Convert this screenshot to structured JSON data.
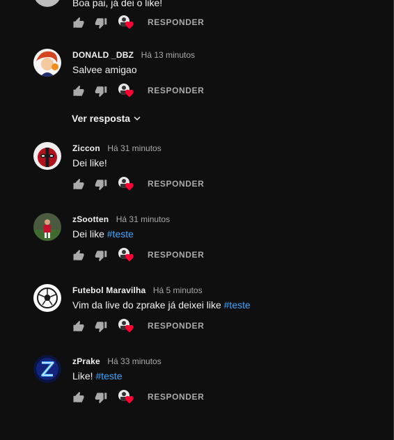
{
  "comments": [
    {
      "author": "",
      "time": "",
      "text": "Boa pai, já dei o like!",
      "hashtag": "",
      "avatar": "partial-avatar-icon",
      "reply_label": "RESPONDER"
    },
    {
      "author": "DONALD _DBZ",
      "time": "Há 13 minutos",
      "text": "Salvee amigao",
      "hashtag": "",
      "avatar": "cartoon-avatar-icon",
      "reply_label": "RESPONDER"
    },
    {
      "author": "Ziccon",
      "time": "Há 31 minutos",
      "text": "Dei like!",
      "hashtag": "",
      "avatar": "deadpool-avatar-icon",
      "reply_label": "RESPONDER"
    },
    {
      "author": "zSootten",
      "time": "Há 31 minutos",
      "text": "Dei like",
      "hashtag": "#teste",
      "avatar": "soccer-player-avatar-icon",
      "reply_label": "RESPONDER"
    },
    {
      "author": "Futebol Maravilha",
      "time": "Há 5 minutos",
      "text": "Vim da live do zprake já deixei like",
      "hashtag": "#teste",
      "avatar": "soccer-ball-avatar-icon",
      "reply_label": "RESPONDER"
    },
    {
      "author": "zPrake",
      "time": "Há 33 minutos",
      "text": "Like!",
      "hashtag": "#teste",
      "avatar": "z-logo-avatar-icon",
      "reply_label": "RESPONDER"
    }
  ],
  "view_replies_label": "Ver resposta",
  "colors": {
    "background": "#0f0f0f",
    "text": "#f1f1f1",
    "secondary_text": "#aaaaaa",
    "hashtag": "#3ea6ff",
    "heart": "#ff0033"
  }
}
